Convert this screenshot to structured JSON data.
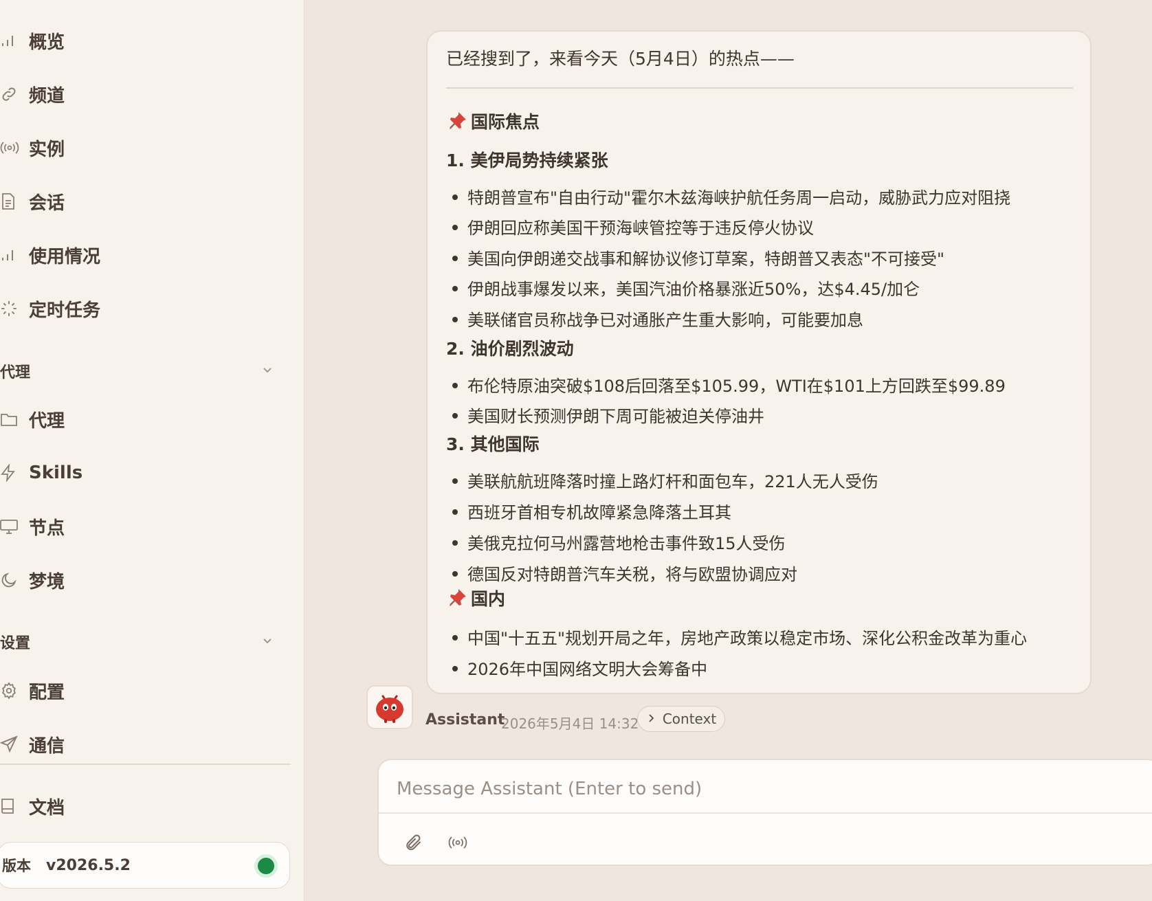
{
  "sidebar": {
    "items": [
      {
        "label": "概览",
        "icon": "bar-chart-icon"
      },
      {
        "label": "频道",
        "icon": "link-icon"
      },
      {
        "label": "实例",
        "icon": "broadcast-icon"
      },
      {
        "label": "会话",
        "icon": "document-icon"
      },
      {
        "label": "使用情况",
        "icon": "bar-chart-icon"
      },
      {
        "label": "定时任务",
        "icon": "loader-icon"
      }
    ],
    "agent_section": {
      "title": "代理",
      "items": [
        {
          "label": "代理",
          "icon": "folder-icon"
        },
        {
          "label": "Skills",
          "icon": "bolt-icon"
        },
        {
          "label": "节点",
          "icon": "monitor-icon"
        },
        {
          "label": "梦境",
          "icon": "moon-icon"
        }
      ]
    },
    "settings_section": {
      "title": "设置",
      "items": [
        {
          "label": "配置",
          "icon": "gear-icon"
        },
        {
          "label": "通信",
          "icon": "send-icon"
        }
      ]
    },
    "docs": {
      "label": "文档",
      "icon": "book-icon"
    },
    "version": {
      "label": "版本",
      "value": "v2026.5.2",
      "status_color": "#1a8a44"
    }
  },
  "message": {
    "intro": "已经搜到了，来看今天（5月4日）的热点——",
    "section_international": "国际焦点",
    "h1": "1. 美伊局势持续紧张",
    "h1_items": [
      "特朗普宣布\"自由行动\"霍尔木兹海峡护航任务周一启动，威胁武力应对阻挠",
      "伊朗回应称美国干预海峡管控等于违反停火协议",
      "美国向伊朗递交战事和解协议修订草案，特朗普又表态\"不可接受\"",
      "伊朗战事爆发以来，美国汽油价格暴涨近50%，达$4.45/加仑",
      "美联储官员称战争已对通胀产生重大影响，可能要加息"
    ],
    "h2": "2. 油价剧烈波动",
    "h2_items": [
      "布伦特原油突破$108后回落至$105.99，WTI在$101上方回跌至$99.89",
      "美国财长预测伊朗下周可能被迫关停油井"
    ],
    "h3": "3. 其他国际",
    "h3_items": [
      "美联航航班降落时撞上路灯杆和面包车，221人无人受伤",
      "西班牙首相专机故障紧急降落土耳其",
      "美俄克拉何马州露营地枪击事件致15人受伤",
      "德国反对特朗普汽车关税，将与欧盟协调应对"
    ],
    "section_domestic": "国内",
    "domestic_items": [
      "中国\"十五五\"规划开局之年，房地产政策以稳定市场、深化公积金改革为重心",
      "2026年中国网络文明大会筹备中"
    ],
    "author": "Assistant",
    "timestamp": "2026年5月4日 14:32",
    "context_label": "Context"
  },
  "composer": {
    "placeholder": "Message Assistant (Enter to send)",
    "value": ""
  },
  "colors": {
    "sidebar_bg": "#f8f2ec",
    "main_bg": "#efe6e0",
    "text": "#3f352f",
    "status_ok": "#1a8a44",
    "pin_red": "#d9443a"
  }
}
